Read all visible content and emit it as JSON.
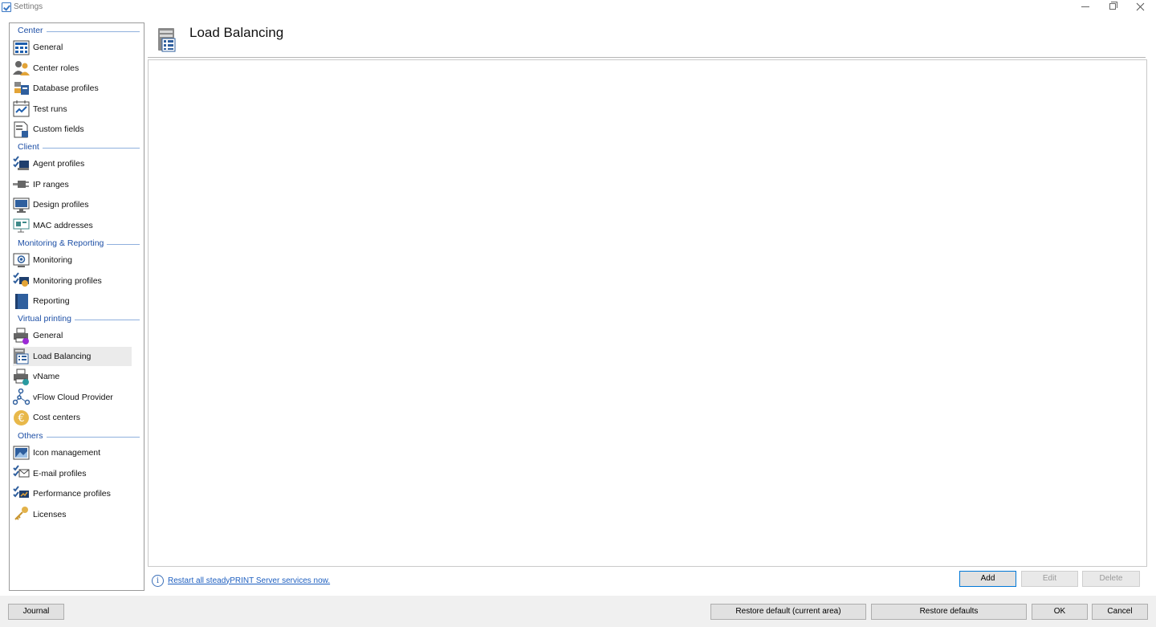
{
  "window": {
    "title": "Settings"
  },
  "sidebar": {
    "sections": [
      {
        "heading": "Center",
        "items": [
          {
            "label": "General",
            "icon": "grid-table-icon"
          },
          {
            "label": "Center roles",
            "icon": "users-icon"
          },
          {
            "label": "Database profiles",
            "icon": "database-icon"
          },
          {
            "label": "Test runs",
            "icon": "chart-calendar-icon"
          },
          {
            "label": "Custom fields",
            "icon": "document-fields-icon"
          }
        ]
      },
      {
        "heading": "Client",
        "items": [
          {
            "label": "Agent profiles",
            "icon": "agent-check-icon"
          },
          {
            "label": "IP ranges",
            "icon": "network-plug-icon"
          },
          {
            "label": "Design profiles",
            "icon": "monitor-design-icon"
          },
          {
            "label": "MAC addresses",
            "icon": "network-card-icon"
          }
        ]
      },
      {
        "heading": "Monitoring & Reporting",
        "items": [
          {
            "label": "Monitoring",
            "icon": "monitor-eye-icon"
          },
          {
            "label": "Monitoring profiles",
            "icon": "monitor-check-icon"
          },
          {
            "label": "Reporting",
            "icon": "book-icon"
          }
        ]
      },
      {
        "heading": "Virtual printing",
        "items": [
          {
            "label": "General",
            "icon": "printer-purple-icon"
          },
          {
            "label": "Load Balancing",
            "icon": "server-balance-icon",
            "selected": true
          },
          {
            "label": "vName",
            "icon": "printer-teal-icon"
          },
          {
            "label": "vFlow Cloud Provider",
            "icon": "network-nodes-icon"
          },
          {
            "label": "Cost centers",
            "icon": "euro-coin-icon"
          }
        ]
      },
      {
        "heading": "Others",
        "items": [
          {
            "label": "Icon management",
            "icon": "image-manage-icon"
          },
          {
            "label": "E-mail profiles",
            "icon": "email-check-icon"
          },
          {
            "label": "Performance profiles",
            "icon": "performance-check-icon"
          },
          {
            "label": "Licenses",
            "icon": "key-icon"
          }
        ]
      }
    ]
  },
  "content": {
    "title": "Load Balancing",
    "icon": "server-balance-icon"
  },
  "info": {
    "link_text": "Restart all steadyPRINT Server services now."
  },
  "actions": {
    "add": "Add",
    "edit": "Edit",
    "delete": "Delete"
  },
  "footer": {
    "journal": "Journal",
    "restore_current": "Restore default (current area)",
    "restore_all": "Restore defaults",
    "ok": "OK",
    "cancel": "Cancel"
  },
  "colors": {
    "accent": "#1d4fa6",
    "link": "#1e5fc0",
    "selected_bg": "#ebebeb",
    "primary_border": "#0078d7"
  }
}
